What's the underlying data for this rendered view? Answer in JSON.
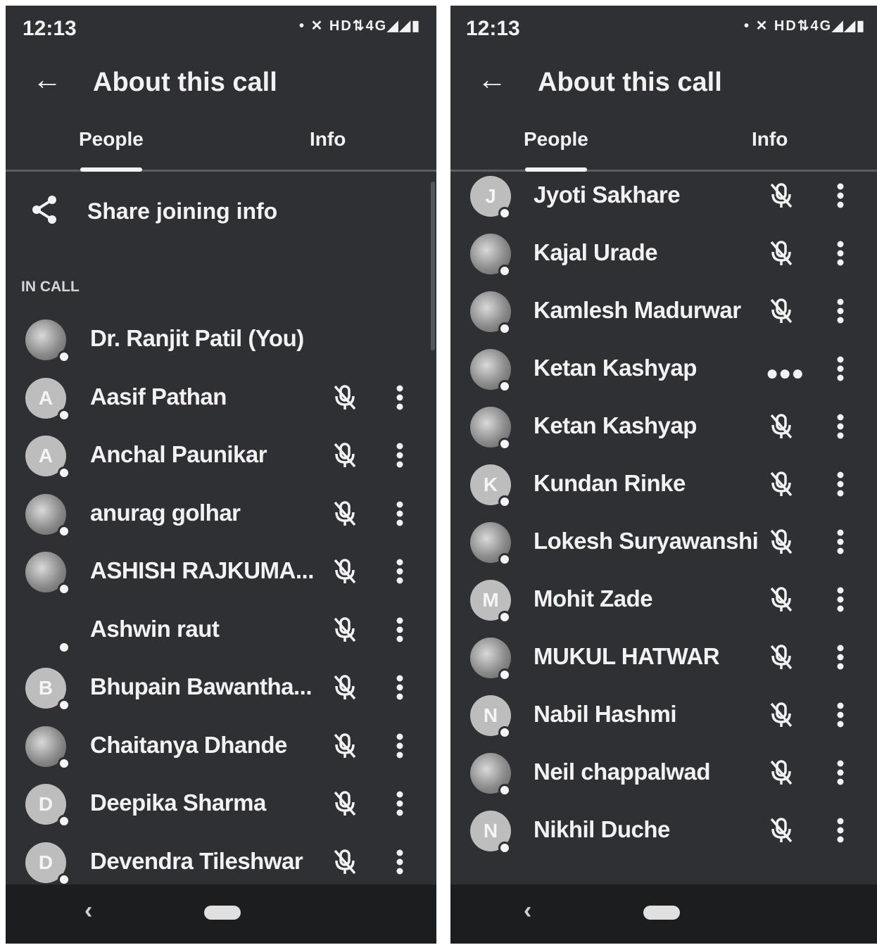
{
  "left": {
    "status": {
      "time": "12:13",
      "indicators": "• ✕ HD⇅4G◢◢▮"
    },
    "header": {
      "back_icon": "arrow-left",
      "title": "About this call"
    },
    "tabs": [
      {
        "label": "People",
        "selected": true
      },
      {
        "label": "Info",
        "selected": false
      }
    ],
    "share_label": "Share joining info",
    "section_label": "IN CALL",
    "participants": [
      {
        "avatar": "photo",
        "initial": "",
        "name": "Dr. Ranjit Patil (You)",
        "mic": "",
        "more": false
      },
      {
        "avatar": "letter",
        "initial": "A",
        "name": "Aasif Pathan",
        "mic": "muted",
        "more": true
      },
      {
        "avatar": "letter",
        "initial": "A",
        "name": "Anchal Paunikar",
        "mic": "muted",
        "more": true
      },
      {
        "avatar": "photo",
        "initial": "",
        "name": "anurag golhar",
        "mic": "muted",
        "more": true
      },
      {
        "avatar": "photo",
        "initial": "",
        "name": "ASHISH RAJKUMA...",
        "mic": "muted",
        "more": true
      },
      {
        "avatar": "none",
        "initial": "",
        "name": "Ashwin raut",
        "mic": "muted",
        "more": true
      },
      {
        "avatar": "letter",
        "initial": "B",
        "name": "Bhupain Bawantha...",
        "mic": "muted",
        "more": true
      },
      {
        "avatar": "photo",
        "initial": "",
        "name": "Chaitanya Dhande",
        "mic": "muted",
        "more": true
      },
      {
        "avatar": "letter",
        "initial": "D",
        "name": "Deepika Sharma",
        "mic": "muted",
        "more": true
      },
      {
        "avatar": "letter",
        "initial": "D",
        "name": "Devendra Tileshwar",
        "mic": "muted",
        "more": true
      }
    ],
    "nav": {
      "back": "‹"
    }
  },
  "right": {
    "status": {
      "time": "12:13",
      "indicators": "• ✕ HD⇅4G◢◢▮"
    },
    "header": {
      "back_icon": "arrow-left",
      "title": "About this call"
    },
    "tabs": [
      {
        "label": "People",
        "selected": true
      },
      {
        "label": "Info",
        "selected": false
      }
    ],
    "participants": [
      {
        "avatar": "letter",
        "initial": "J",
        "name": "Jyoti Sakhare",
        "mic": "muted",
        "more": true
      },
      {
        "avatar": "photo",
        "initial": "",
        "name": "Kajal Urade",
        "mic": "muted",
        "more": true
      },
      {
        "avatar": "photo",
        "initial": "",
        "name": "Kamlesh Madurwar",
        "mic": "muted",
        "more": true
      },
      {
        "avatar": "photo",
        "initial": "",
        "name": "Ketan Kashyap",
        "mic": "speaking",
        "more": true
      },
      {
        "avatar": "photo",
        "initial": "",
        "name": "Ketan Kashyap",
        "mic": "muted",
        "more": true
      },
      {
        "avatar": "letter",
        "initial": "K",
        "name": "Kundan Rinke",
        "mic": "muted",
        "more": true
      },
      {
        "avatar": "photo",
        "initial": "",
        "name": "Lokesh Suryawanshi",
        "mic": "muted",
        "more": true
      },
      {
        "avatar": "letter",
        "initial": "M",
        "name": "Mohit Zade",
        "mic": "muted",
        "more": true
      },
      {
        "avatar": "photo",
        "initial": "",
        "name": "MUKUL HATWAR",
        "mic": "muted",
        "more": true
      },
      {
        "avatar": "letter",
        "initial": "N",
        "name": "Nabil Hashmi",
        "mic": "muted",
        "more": true
      },
      {
        "avatar": "photo",
        "initial": "",
        "name": "Neil chappalwad",
        "mic": "muted",
        "more": true
      },
      {
        "avatar": "letter",
        "initial": "N",
        "name": "Nikhil Duche",
        "mic": "muted",
        "more": true
      }
    ],
    "nav": {
      "back": "‹"
    }
  },
  "colors": {
    "background": "#2f3033",
    "text": "#f2f2f2",
    "avatar": "#bdbdbd",
    "navbar": "#1c1d1f"
  }
}
